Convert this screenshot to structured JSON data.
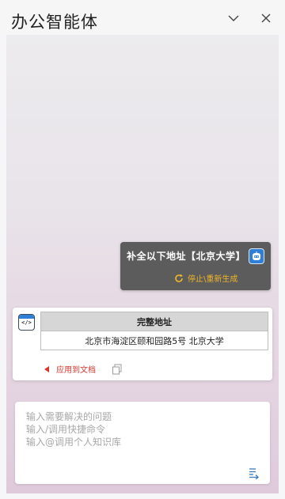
{
  "window": {
    "title": "办公智能体"
  },
  "conversation": {
    "user_message": {
      "text": "补全以下地址【北京大学】",
      "action_label": "停止\\重新生成"
    },
    "assistant_message": {
      "table": {
        "header": "完整地址",
        "rows": [
          "北京市海淀区颐和园路5号 北京大学"
        ]
      },
      "apply_label": "应用到文档"
    }
  },
  "input": {
    "placeholder_lines": [
      "输入需要解决的问题",
      "输入/调用快捷命令",
      "输入@调用个人知识库"
    ]
  },
  "colors": {
    "user_bubble": "#5c5c5c",
    "accent_orange": "#f0b429",
    "apply_red": "#d9372e"
  }
}
